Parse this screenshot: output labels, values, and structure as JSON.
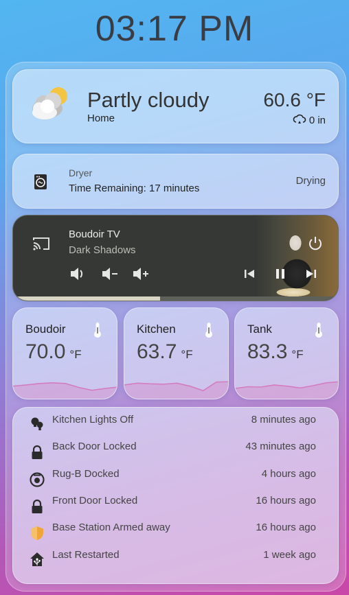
{
  "clock": {
    "time": "03:17 PM"
  },
  "weather": {
    "condition": "Partly cloudy",
    "location": "Home",
    "temperature": "60.6 °F",
    "precipitation": "0 in",
    "icon": "partly-cloudy-icon"
  },
  "dryer": {
    "name": "Dryer",
    "remaining": "Time Remaining: 17 minutes",
    "state": "Drying",
    "icon": "dryer-icon"
  },
  "media": {
    "device": "Boudoir TV",
    "title": "Dark Shadows",
    "progress": 0.45,
    "icons": [
      "cast-icon",
      "volume-mute-icon",
      "volume-down-icon",
      "volume-up-icon",
      "previous-icon",
      "pause-icon",
      "next-icon",
      "power-icon"
    ]
  },
  "sensors": [
    {
      "name": "Boudoir",
      "value": "70.0",
      "unit": "°F",
      "trend": [
        0.55,
        0.62,
        0.7,
        0.74,
        0.7,
        0.48,
        0.32,
        0.42,
        0.5
      ]
    },
    {
      "name": "Kitchen",
      "value": "63.7",
      "unit": "°F",
      "trend": [
        0.62,
        0.72,
        0.68,
        0.66,
        0.72,
        0.55,
        0.3,
        0.78,
        0.8
      ]
    },
    {
      "name": "Tank",
      "value": "83.3",
      "unit": "°F",
      "trend": [
        0.42,
        0.52,
        0.5,
        0.62,
        0.55,
        0.45,
        0.58,
        0.74,
        0.8
      ]
    }
  ],
  "logbook": [
    {
      "label": "Kitchen Lights Off",
      "time": "8 minutes ago",
      "icon": "lightbulb-group-icon"
    },
    {
      "label": "Back Door Locked",
      "time": "43 minutes ago",
      "icon": "lock-icon"
    },
    {
      "label": "Rug-B Docked",
      "time": "4 hours ago",
      "icon": "robot-vacuum-icon"
    },
    {
      "label": "Front Door Locked",
      "time": "16 hours ago",
      "icon": "lock-icon"
    },
    {
      "label": "Base Station Armed away",
      "time": "16 hours ago",
      "icon": "shield-icon"
    },
    {
      "label": "Last Restarted",
      "time": "1 week ago",
      "icon": "home-assistant-icon"
    }
  ],
  "colors": {
    "shield": "#f0a53a",
    "icon_dark": "#2b2b2b"
  }
}
